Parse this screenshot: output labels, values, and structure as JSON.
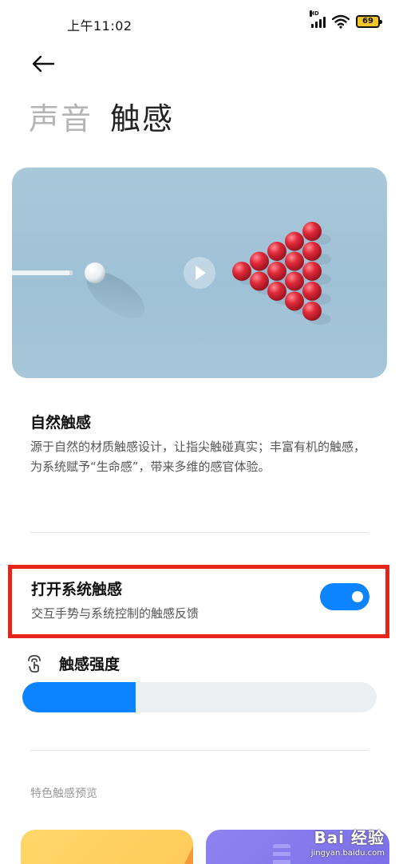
{
  "status_bar": {
    "time": "上午11:02",
    "network_badge": "HD",
    "battery": "69",
    "icons": [
      "signal-icon",
      "wifi-icon",
      "battery-icon"
    ]
  },
  "nav": {
    "back_icon": "arrow-left-icon"
  },
  "tabs": [
    {
      "label": "声音",
      "active": false
    },
    {
      "label": "触感",
      "active": true
    }
  ],
  "hero": {
    "play_icon": "play-icon",
    "description": "billiard balls illustration"
  },
  "natural": {
    "title": "自然触感",
    "desc": "源于自然的材质触感设计，让指尖触碰真实；丰富有机的触感，为系统赋予“生命感”，带来多维的感官体验。"
  },
  "system_haptics": {
    "title": "打开系统触感",
    "subtitle": "交互手势与系统控制的触感反馈",
    "enabled": true
  },
  "strength": {
    "label": "触感强度",
    "icon": "touch-icon",
    "level": 0.32
  },
  "preview": {
    "title": "特色触感预览"
  },
  "watermark": {
    "main": "Bai 经验",
    "sub": "jingyan.baidu.com"
  },
  "colors": {
    "accent": "#0d84ff",
    "highlight_border": "#e5251b",
    "inactive_tab": "#b4b4b4",
    "ball_red": "#e02a3a"
  }
}
